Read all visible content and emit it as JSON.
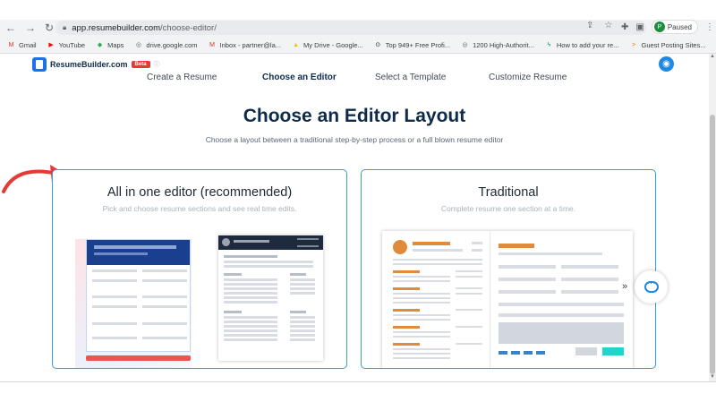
{
  "browser": {
    "url_host": "app.resumebuilder.com",
    "url_path": "/choose-editor/",
    "profile_status": "Paused",
    "profile_initial": "P",
    "bookmarks": [
      {
        "label": "Gmail",
        "icon": "gmail-icon",
        "color": "#d93025",
        "glyph": "M"
      },
      {
        "label": "YouTube",
        "icon": "youtube-icon",
        "color": "#ff0000",
        "glyph": "▶"
      },
      {
        "label": "Maps",
        "icon": "maps-icon",
        "color": "#34a853",
        "glyph": "◆"
      },
      {
        "label": "drive.google.com",
        "icon": "globe-icon",
        "color": "#5f6368",
        "glyph": "◎"
      },
      {
        "label": "Inbox - partner@la...",
        "icon": "inbox-icon",
        "color": "#d93025",
        "glyph": "M"
      },
      {
        "label": "My Drive - Google...",
        "icon": "drive-icon",
        "color": "#fbbc04",
        "glyph": "▲"
      },
      {
        "label": "Top 949+ Free Profi...",
        "icon": "link-icon",
        "color": "#202124",
        "glyph": "⊙"
      },
      {
        "label": "1200 High-Authorit...",
        "icon": "globe-icon",
        "color": "#5f6368",
        "glyph": "◎"
      },
      {
        "label": "How to add your re...",
        "icon": "bolt-icon",
        "color": "#0f9d58",
        "glyph": "ϟ"
      },
      {
        "label": "Guest Posting Sites...",
        "icon": "arrow-icon",
        "color": "#e8710a",
        "glyph": ">"
      }
    ]
  },
  "header": {
    "logo_text": "ResumeBuilder.com",
    "beta_label": "Beta"
  },
  "steps": [
    {
      "label": "Create a Resume"
    },
    {
      "label": "Choose an Editor"
    },
    {
      "label": "Select a Template"
    },
    {
      "label": "Customize Resume"
    }
  ],
  "main": {
    "title": "Choose an Editor Layout",
    "subtitle": "Choose a layout between a traditional step-by-step process or a full blown resume editor"
  },
  "cards": [
    {
      "title": "All in one editor (recommended)",
      "description": "Pick and choose resume sections and see real time edits."
    },
    {
      "title": "Traditional",
      "description": "Complete resume one section at a time."
    }
  ],
  "colors": {
    "accent": "#1e88e5",
    "navy": "#0d2b4b",
    "card_border": "#3b9be0",
    "arrow": "#e53935"
  }
}
